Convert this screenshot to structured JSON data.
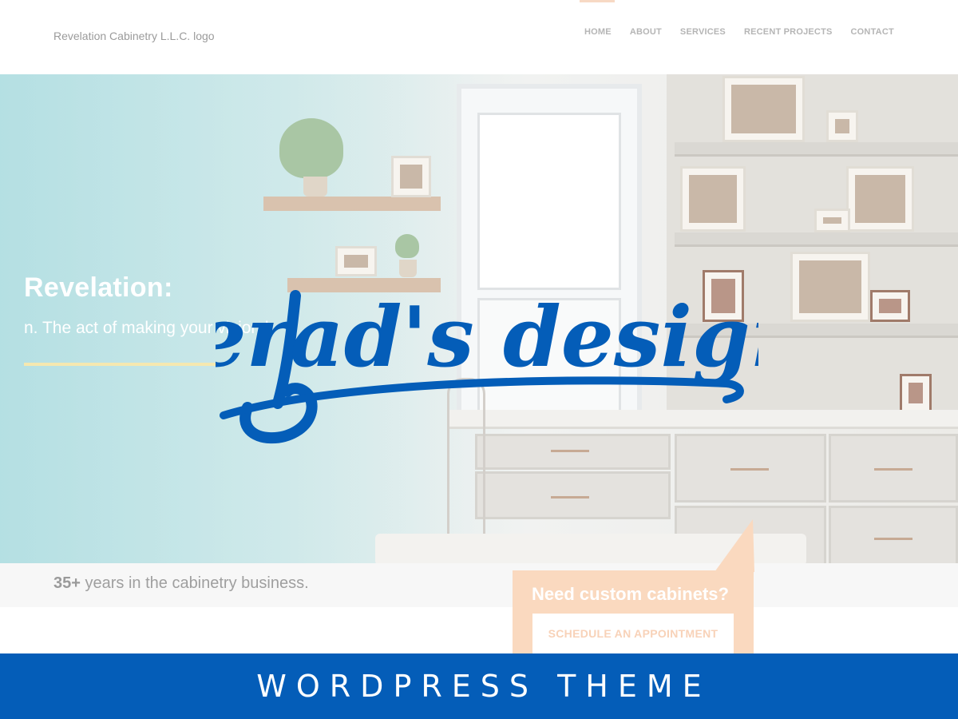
{
  "header": {
    "logo_alt": "Revelation Cabinetry L.L.C. logo",
    "nav": [
      {
        "label": "HOME"
      },
      {
        "label": "ABOUT"
      },
      {
        "label": "SERVICES"
      },
      {
        "label": "RECENT PROJECTS"
      },
      {
        "label": "CONTACT"
      }
    ],
    "active_nav": "HOME"
  },
  "hero": {
    "title": "Revelation:",
    "subtitle": "n. The act of making your vision k",
    "accent_color": "#f5e8b0"
  },
  "watermark": {
    "text": "jerad's design",
    "color": "#045db8"
  },
  "years": {
    "number": "35+",
    "text": " years in the cabinetry business."
  },
  "cta": {
    "heading": "Need custom cabinets?",
    "button_label": "SCHEDULE AN APPOINTMENT",
    "color": "#fad9bf"
  },
  "banner": {
    "text": "WORDPRESS THEME",
    "color": "#045db8"
  }
}
